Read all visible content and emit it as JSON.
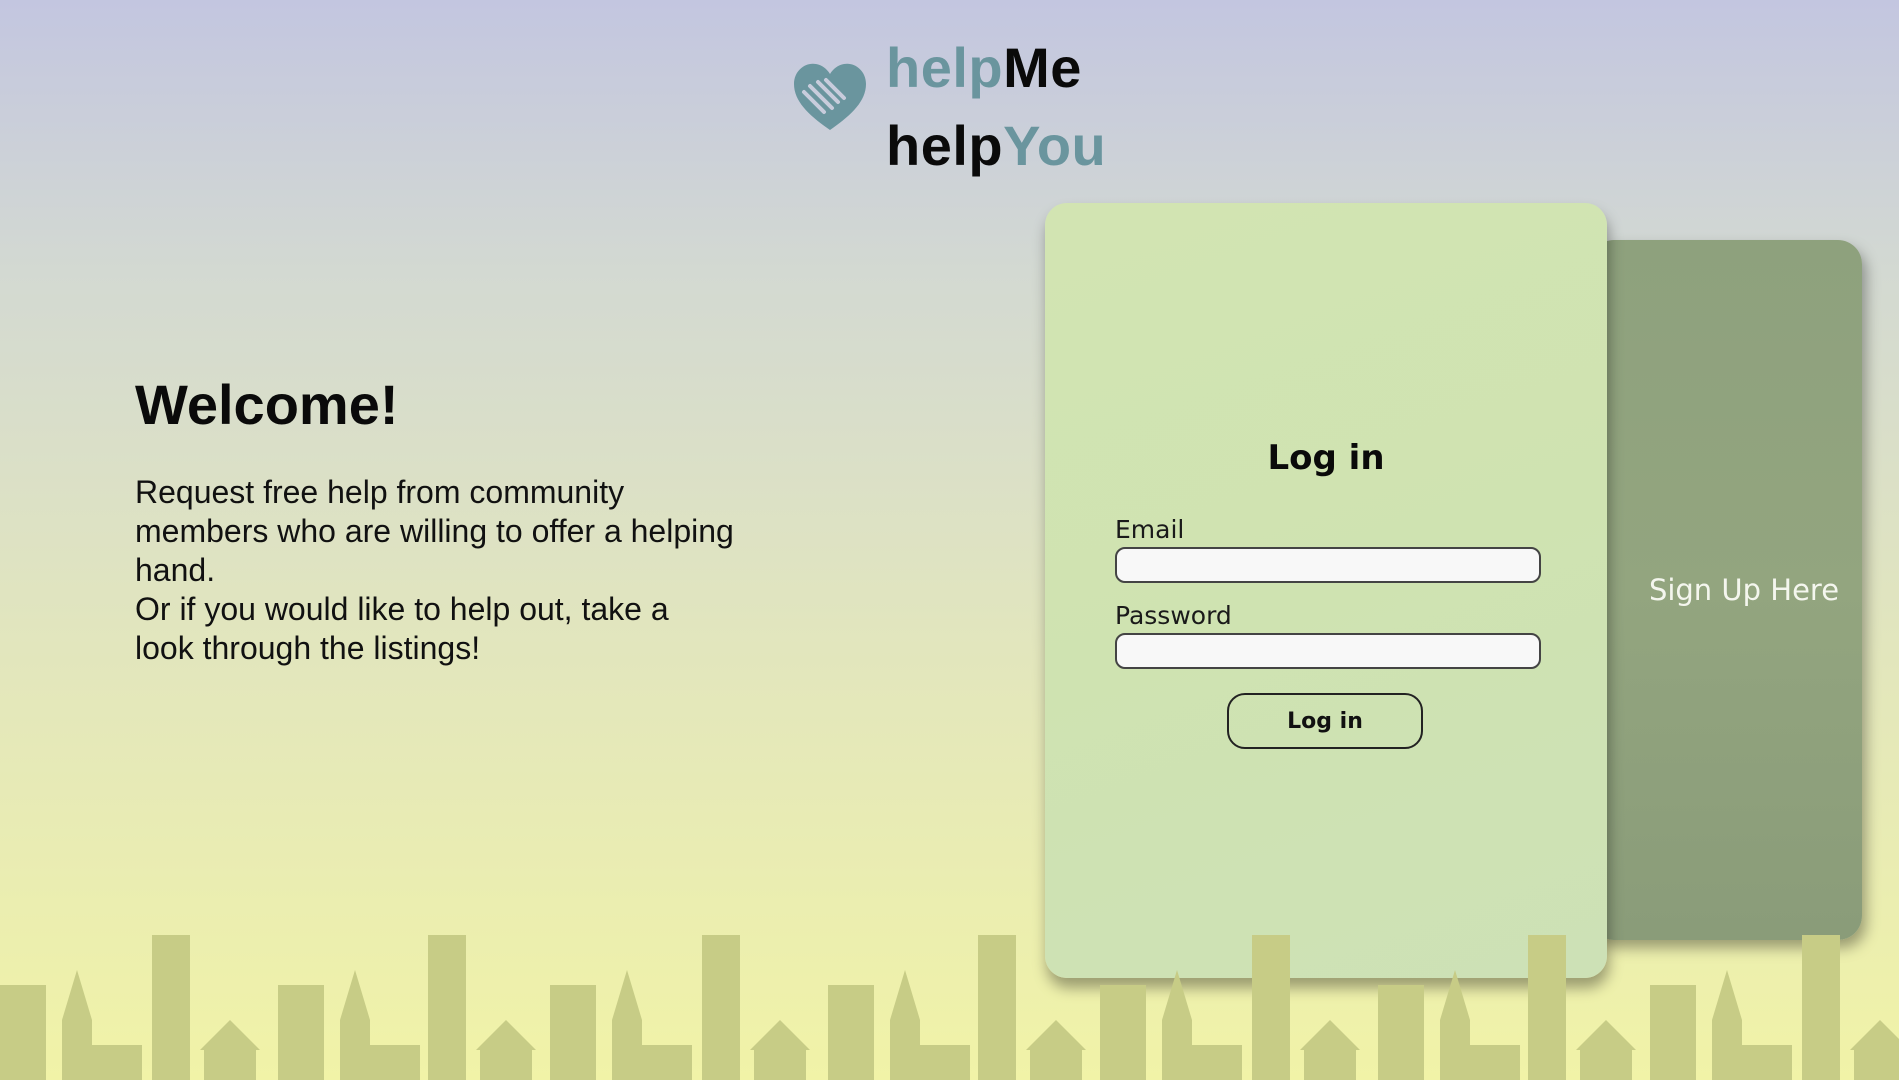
{
  "logo": {
    "line1_a": "help",
    "line1_b": "Me",
    "line2_a": "help",
    "line2_b": "You",
    "icon": "handshake-heart-icon",
    "accent": "#6a959e"
  },
  "welcome": {
    "heading": "Welcome!",
    "line1": "Request free help from community members who are willing to offer a helping hand.",
    "line2": "Or if you would like to help out, take a look through the listings!"
  },
  "login": {
    "title": "Log in",
    "email_label": "Email",
    "email_value": "",
    "password_label": "Password",
    "password_value": "",
    "button_label": "Log in"
  },
  "signup": {
    "label": "Sign Up Here"
  },
  "colors": {
    "login_card": "#cfe3b1",
    "signup_card": "#8fa27e",
    "skyline": "#c7cc86"
  }
}
